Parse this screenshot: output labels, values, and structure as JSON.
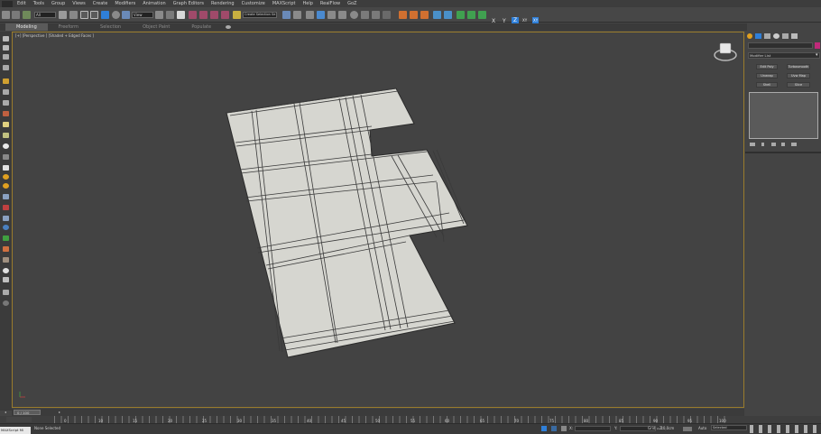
{
  "menu": {
    "items": [
      "Edit",
      "Tools",
      "Group",
      "Views",
      "Create",
      "Modifiers",
      "Animation",
      "Graph Editors",
      "Rendering",
      "Customize",
      "MAXScript",
      "Help",
      "RealFlow",
      "GoZ"
    ]
  },
  "toolbar": {
    "selection_filter": "All",
    "coord_system": "View",
    "named_selection": "Create Selection Se",
    "axis_x": "X",
    "axis_y": "Y",
    "axis_z": "Z",
    "axis_xy": "XY",
    "axis_xy2": "XY"
  },
  "ribbon": {
    "tabs": [
      "Modeling",
      "Freeform",
      "Selection",
      "Object Paint",
      "Populate"
    ]
  },
  "viewport": {
    "label": "[+] [Perspective ] [Shaded + Edged Faces ]"
  },
  "command_panel": {
    "modifier_list": "Modifier List",
    "buttons": [
      "Edit Poly",
      "Turbosmooth",
      "Unwrap UVW",
      "Uvw Map",
      "Shell",
      "Slice"
    ]
  },
  "timeline": {
    "slider_label": "0 / 100",
    "ticks": [
      "0",
      "5",
      "10",
      "15",
      "20",
      "25",
      "30",
      "35",
      "40",
      "45",
      "50",
      "55",
      "60",
      "65",
      "70",
      "75",
      "80",
      "85",
      "90",
      "95",
      "100"
    ]
  },
  "status": {
    "maxscript_label": "MAXScript Mi",
    "selection_text": "None Selected",
    "x_label": "X:",
    "y_label": "Y:",
    "z_label": "Z:",
    "grid_text": "Grid = 10,0cm",
    "autokey_label": "Auto",
    "setkey_value": "Selected"
  },
  "colors": {
    "accent": "#2f7fd8",
    "viewport_border": "#9a7c2c",
    "mesh_face": "#d6d6d0"
  }
}
